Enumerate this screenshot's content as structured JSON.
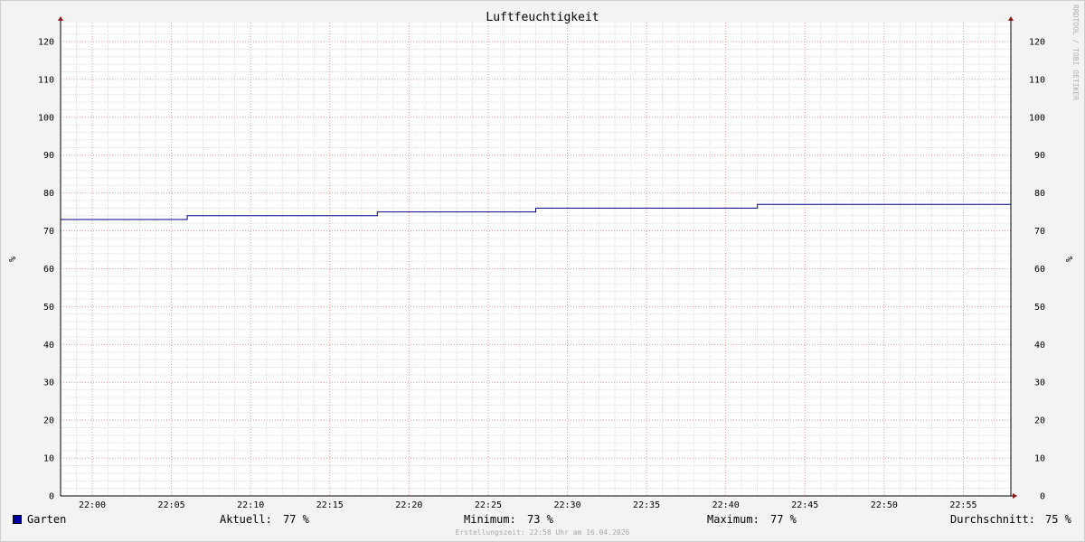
{
  "chart_data": {
    "type": "line",
    "title": "Luftfeuchtigkeit",
    "ylabel": "%",
    "ylim": [
      0,
      125
    ],
    "y_ticks": [
      0,
      10,
      20,
      30,
      40,
      50,
      60,
      70,
      80,
      90,
      100,
      110,
      120
    ],
    "x_range": [
      "21:58",
      "22:58"
    ],
    "x_ticks": [
      "22:00",
      "22:05",
      "22:10",
      "22:15",
      "22:20",
      "22:25",
      "22:30",
      "22:35",
      "22:40",
      "22:45",
      "22:50",
      "22:55"
    ],
    "grid": true,
    "watermark": "RRDTOOL / TOBI OETIKER",
    "series": [
      {
        "name": "Garten",
        "color": "#000080",
        "x": [
          "21:58",
          "22:06",
          "22:06",
          "22:18",
          "22:18",
          "22:28",
          "22:28",
          "22:42",
          "22:42",
          "22:58"
        ],
        "values": [
          73,
          73,
          74,
          74,
          75,
          75,
          76,
          76,
          77,
          77
        ]
      }
    ],
    "legend": {
      "series_name": "Garten",
      "swatch_color": "#0000a0",
      "current_label": "Aktuell:",
      "current_value": "77 %",
      "min_label": "Minimum:",
      "min_value": "73 %",
      "max_label": "Maximum:",
      "max_value": "77 %",
      "avg_label": "Durchschnitt:",
      "avg_value": "75 %"
    },
    "footer": "Erstellungszeit: 22:58 Uhr am 16.04.2026"
  }
}
